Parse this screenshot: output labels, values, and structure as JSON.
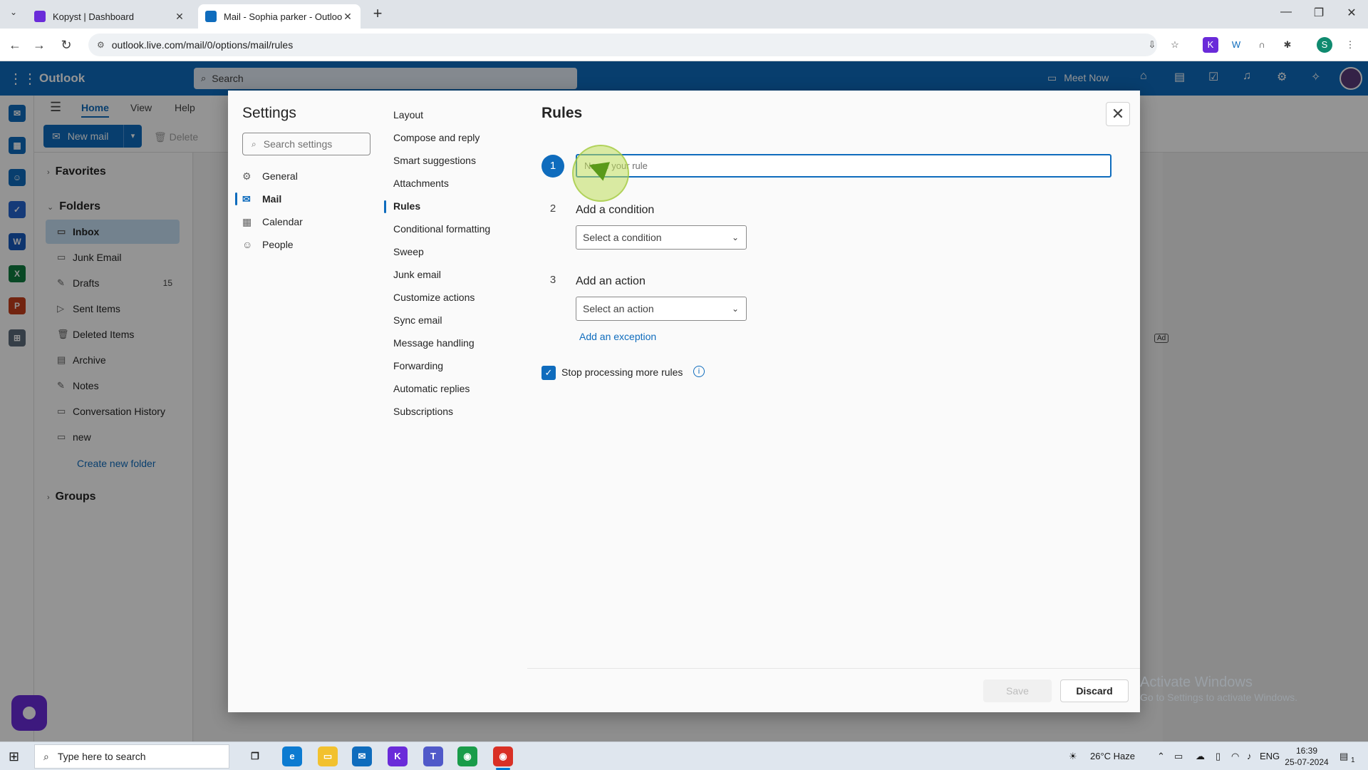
{
  "browser": {
    "tabs": [
      {
        "title": "Kopyst | Dashboard",
        "favicon_color": "#6a2bd9"
      },
      {
        "title": "Mail - Sophia parker - Outlook",
        "favicon_color": "#0f6cbd"
      }
    ],
    "new_tab_label": "+",
    "url": "outlook.live.com/mail/0/options/mail/rules",
    "profile_initial": "S"
  },
  "outlook": {
    "brand": "Outlook",
    "search_placeholder": "Search",
    "meet_now": "Meet Now",
    "ribbon_tabs": [
      "Home",
      "View",
      "Help"
    ],
    "new_mail": "New mail",
    "delete": "Delete",
    "favorites": "Favorites",
    "folders_header": "Folders",
    "folders": [
      {
        "label": "Inbox",
        "icon": "inbox-icon",
        "count": ""
      },
      {
        "label": "Junk Email",
        "icon": "junk-icon",
        "count": ""
      },
      {
        "label": "Drafts",
        "icon": "drafts-icon",
        "count": "15"
      },
      {
        "label": "Sent Items",
        "icon": "sent-icon",
        "count": ""
      },
      {
        "label": "Deleted Items",
        "icon": "trash-icon",
        "count": ""
      },
      {
        "label": "Archive",
        "icon": "archive-icon",
        "count": ""
      },
      {
        "label": "Notes",
        "icon": "notes-icon",
        "count": ""
      },
      {
        "label": "Conversation History",
        "icon": "folder-icon",
        "count": ""
      },
      {
        "label": "new",
        "icon": "folder-icon",
        "count": ""
      }
    ],
    "create_folder": "Create new folder",
    "groups": "Groups",
    "ad_badge": "Ad"
  },
  "settings": {
    "title": "Settings",
    "search_placeholder": "Search settings",
    "categories": [
      {
        "label": "General",
        "icon": "gear-icon"
      },
      {
        "label": "Mail",
        "icon": "mail-icon"
      },
      {
        "label": "Calendar",
        "icon": "calendar-icon"
      },
      {
        "label": "People",
        "icon": "people-icon"
      }
    ],
    "selected_category": "Mail",
    "mail_sections": [
      "Layout",
      "Compose and reply",
      "Smart suggestions",
      "Attachments",
      "Rules",
      "Conditional formatting",
      "Sweep",
      "Junk email",
      "Customize actions",
      "Sync email",
      "Message handling",
      "Forwarding",
      "Automatic replies",
      "Subscriptions"
    ],
    "selected_section": "Rules"
  },
  "rules": {
    "title": "Rules",
    "step1_number": "1",
    "name_placeholder": "Name your rule",
    "name_value": "",
    "step2_number": "2",
    "step2_label": "Add a condition",
    "condition_placeholder": "Select a condition",
    "step3_number": "3",
    "step3_label": "Add an action",
    "action_placeholder": "Select an action",
    "add_exception": "Add an exception",
    "stop_processing_label": "Stop processing more rules",
    "stop_processing_checked": true,
    "save": "Save",
    "discard": "Discard"
  },
  "watermark": {
    "line1": "Activate Windows",
    "line2": "Go to Settings to activate Windows."
  },
  "taskbar": {
    "search_placeholder": "Type here to search",
    "weather": "26°C  Haze",
    "language": "ENG",
    "time": "16:39",
    "date": "25-07-2024",
    "notification_count": "1"
  },
  "colors": {
    "accent": "#0f6cbd",
    "header": "#0f6cbd",
    "selected_folder": "#c7e0f4"
  }
}
